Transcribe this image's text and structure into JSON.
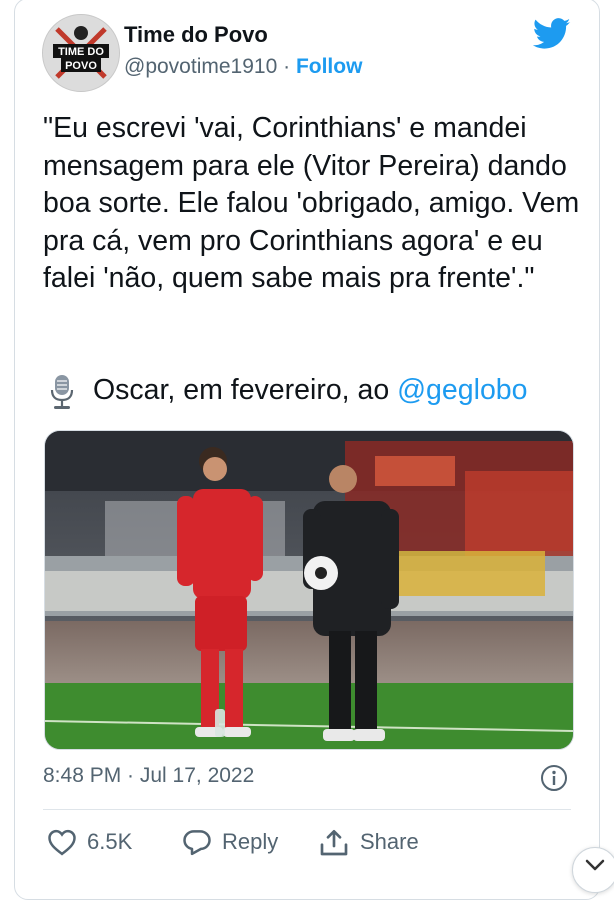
{
  "account": {
    "name": "Time do Povo",
    "handle": "@povotime1910",
    "separator": "·",
    "follow_label": "Follow",
    "avatar_text_top": "TIME DO",
    "avatar_text_bottom": "POVO"
  },
  "tweet": {
    "text": "\"Eu escrevi 'vai, Corinthians' e mandei mensagem para ele (Vitor Pereira) dando boa sorte. Ele falou 'obrigado, amigo. Vem pra cá, vem pro Corinthians agora' e eu falei 'não, quem sabe mais pra frente'.\"",
    "source_prefix": "Oscar, em fevereiro, ao ",
    "source_mention": "@geglobo",
    "timestamp": "8:48 PM · Jul 17, 2022"
  },
  "actions": {
    "likes": "6.5K",
    "reply_label": "Reply",
    "share_label": "Share"
  },
  "colors": {
    "brand_blue": "#1d9bf0",
    "text_secondary": "#536471"
  }
}
